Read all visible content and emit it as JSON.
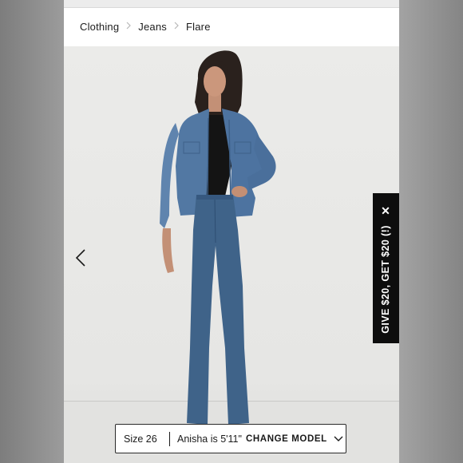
{
  "breadcrumb": {
    "items": [
      "Clothing",
      "Jeans",
      "Flare"
    ]
  },
  "gallery": {
    "prev_icon": "chevron-left-icon"
  },
  "referral": {
    "text": "GIVE $20, GET $20 (!)",
    "close_icon": "close-icon",
    "close_glyph": "✕"
  },
  "model_bar": {
    "size": "Size 26",
    "model_info": "Anisha is 5'11\"",
    "change_label": "CHANGE MODEL",
    "dropdown_icon": "chevron-down-icon"
  },
  "colors": {
    "tab_bg": "#0d0d0d",
    "denim": "#3f6389",
    "jacket": "#5278a3",
    "backdrop": "#e8e8e6"
  }
}
